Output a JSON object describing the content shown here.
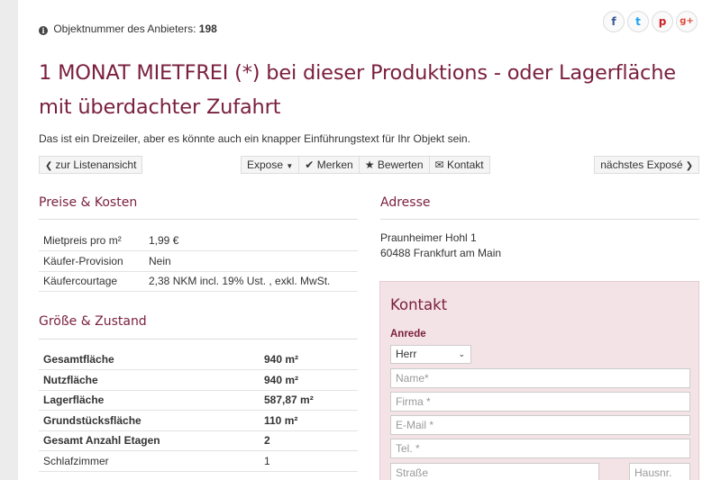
{
  "header": {
    "object_number_label": "Objektnummer des Anbieters:",
    "object_number_value": "198",
    "social": [
      {
        "icon": "facebook-icon",
        "glyph": "f",
        "color": "#3b5998"
      },
      {
        "icon": "twitter-icon",
        "glyph": "t",
        "color": "#1da1f2"
      },
      {
        "icon": "pinterest-icon",
        "glyph": "p",
        "color": "#cb2027"
      },
      {
        "icon": "google-plus-icon",
        "glyph": "g+",
        "color": "#dd4b39"
      }
    ]
  },
  "title": "1 MONAT MIETFREI (*) bei dieser Produktions - oder Lagerfläche mit überdachter Zufahrt",
  "intro": "Das ist ein Dreizeiler, aber es könnte auch ein knapper Einführungstext für Ihr Objekt sein.",
  "toolbar": {
    "back_label": "zur Listenansicht",
    "expose_label": "Expose",
    "merken_label": "Merken",
    "bewerten_label": "Bewerten",
    "kontakt_label": "Kontakt",
    "next_label": "nächstes Exposé"
  },
  "prices": {
    "title": "Preise & Kosten",
    "rows": [
      {
        "label": "Mietpreis pro m²",
        "value": "1,99 €"
      },
      {
        "label": "Käufer-Provision",
        "value": "Nein"
      },
      {
        "label": "Käufercourtage",
        "value": "2,38 NKM incl. 19% Ust. , exkl. MwSt."
      }
    ]
  },
  "size": {
    "title": "Größe & Zustand",
    "rows": [
      {
        "label": "Gesamtfläche",
        "value": "940 m²"
      },
      {
        "label": "Nutzfläche",
        "value": "940 m²"
      },
      {
        "label": "Lagerfläche",
        "value": "587,87 m²"
      },
      {
        "label": "Grundstücksfläche",
        "value": "110 m²"
      },
      {
        "label": "Gesamt Anzahl Etagen",
        "value": "2"
      },
      {
        "label": "Schlafzimmer",
        "value": "1"
      }
    ]
  },
  "address": {
    "title": "Adresse",
    "line1": "Praunheimer Hohl 1",
    "line2": "60488 Frankfurt am Main"
  },
  "contact": {
    "title": "Kontakt",
    "salutation_label": "Anrede",
    "salutation_value": "Herr",
    "name_placeholder": "Name*",
    "company_placeholder": "Firma *",
    "email_placeholder": "E-Mail *",
    "phone_placeholder": "Tel. *",
    "street_placeholder": "Straße",
    "housenr_placeholder": "Hausnr."
  },
  "colors": {
    "accent": "#7a1f3d",
    "contact_bg": "#f3e2e6"
  }
}
